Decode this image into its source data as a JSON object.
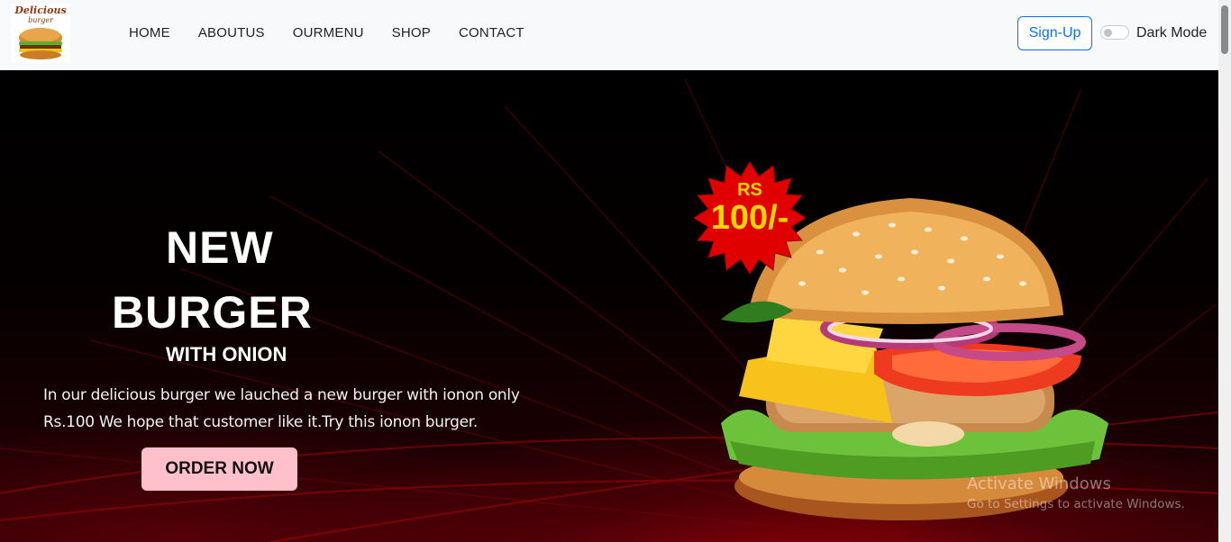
{
  "navbar": {
    "logo": {
      "line1": "Delicious",
      "line2": "burger"
    },
    "links": [
      "HOME",
      "ABOUTUS",
      "OURMENU",
      "SHOP",
      "CONTACT"
    ],
    "signup_label": "Sign-Up",
    "dark_mode_label": "Dark Mode"
  },
  "hero": {
    "title_line1": "NEW",
    "title_line2": "BURGER",
    "subtitle": "WITH ONION",
    "description": "In our delicious burger we lauched a new burger with ionon only Rs.100 We hope that customer like it.Try this ionon burger.",
    "cta_label": "ORDER NOW",
    "price_badge": {
      "currency": "RS",
      "amount": "100/-"
    }
  },
  "overlay": {
    "activate_title": "Activate Windows",
    "activate_sub": "Go to Settings to activate Windows."
  },
  "colors": {
    "nav_bg": "#f8f9fa",
    "accent_blue": "#0d6efd",
    "cta_bg": "#ffc0cb",
    "badge_red": "#e00000",
    "badge_text": "#ffd400"
  },
  "icons": [
    "burger-logo-icon",
    "price-starburst-icon",
    "burger-image"
  ]
}
